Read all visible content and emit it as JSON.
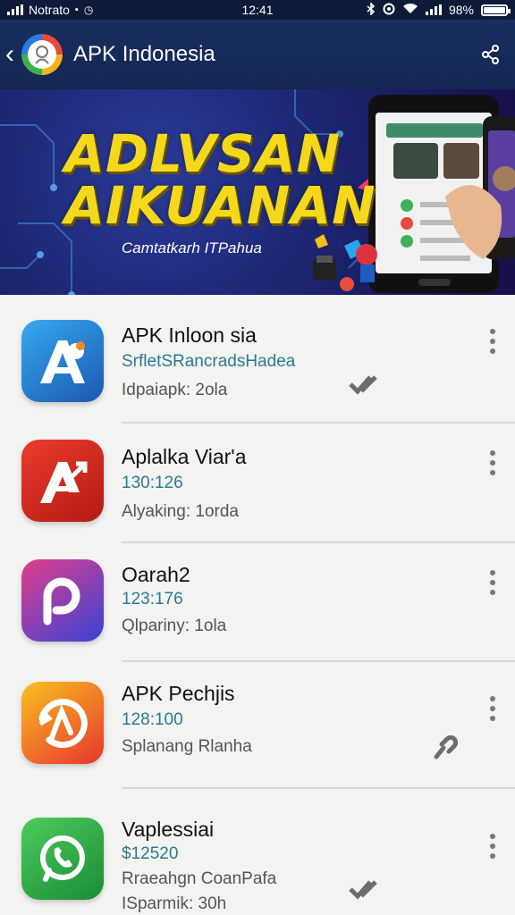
{
  "status_bar": {
    "carrier": "Notrato",
    "time": "12:41",
    "battery": "98%",
    "battery_level": 0.98
  },
  "app_bar": {
    "title": "APK Indonesia",
    "icons": [
      "back-icon",
      "app-logo",
      "share-icon"
    ]
  },
  "banner": {
    "line1": "ADLVSAN",
    "line2": "AIKUANAN",
    "subtitle": "Camtatkarh ITPahua"
  },
  "apps": [
    {
      "name": "APK Inloon sia",
      "line2": "SrfletSRancradsHadea",
      "line3": "Idpaiapk: 2ola",
      "line4": "",
      "status_icon": "double-check-icon",
      "colors": [
        "#2f9ee9",
        "#1d5fb8"
      ]
    },
    {
      "name": "Aplalka Viar'a",
      "line2": "130:126",
      "line3": "Alyaking: 1orda",
      "line4": "",
      "status_icon": "",
      "colors": [
        "#e43a2c",
        "#b81d16"
      ]
    },
    {
      "name": "Oarah2",
      "line2": "123:176",
      "line3": "Qlpariny: 1ola",
      "line4": "",
      "status_icon": "",
      "colors": [
        "#c23ea3",
        "#3b3fd3"
      ]
    },
    {
      "name": "APK Pechjis",
      "line2": "128:100",
      "line3": "Splanang Rlanha",
      "line4": "",
      "status_icon": "link-icon",
      "colors": [
        "#f6c21e",
        "#e6342f"
      ]
    },
    {
      "name": "Vaplessiai",
      "line2": "$12520",
      "line3": "Rraeahgn CoanPafa",
      "line4": "ISparmik: 30h",
      "status_icon": "double-check-icon",
      "colors": [
        "#45c358",
        "#1c8e37"
      ]
    }
  ]
}
